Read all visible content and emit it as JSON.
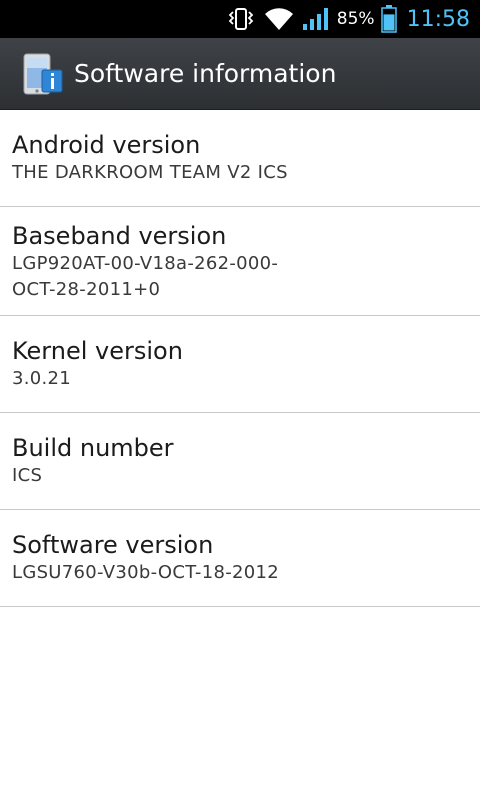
{
  "status_bar": {
    "battery_percent": "85%",
    "battery_level": 0.85,
    "time": "11:58",
    "icons": [
      "vibrate-icon",
      "wifi-icon",
      "signal-icon",
      "battery-icon"
    ],
    "clock_color": "#4fc3f7"
  },
  "header": {
    "title": "Software information",
    "icon": "phone-info-icon"
  },
  "items": [
    {
      "title": "Android version",
      "value": "THE DARKROOM TEAM V2 ICS"
    },
    {
      "title": "Baseband version",
      "value_lines": [
        "LGP920AT-00-V18a-262-000-",
        "OCT-28-2011+0"
      ]
    },
    {
      "title": "Kernel version",
      "value": "3.0.21"
    },
    {
      "title": "Build number",
      "value": "ICS"
    },
    {
      "title": "Software version",
      "value": "LGSU760-V30b-OCT-18-2012"
    }
  ]
}
